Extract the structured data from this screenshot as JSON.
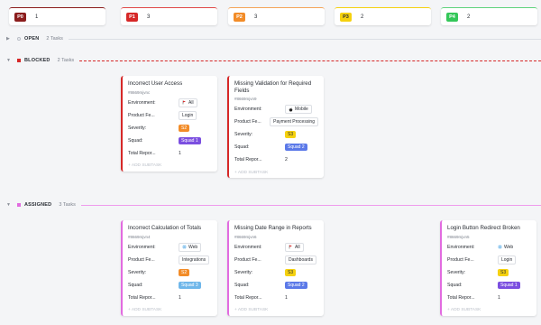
{
  "priorities": [
    {
      "badge": "P0",
      "count": "1",
      "bg": "#8b1d1d",
      "fg": "#ffffff",
      "line": "#8b1d1d"
    },
    {
      "badge": "P1",
      "count": "3",
      "bg": "#d62828",
      "fg": "#ffffff",
      "line": "#e04848"
    },
    {
      "badge": "P2",
      "count": "3",
      "bg": "#f28c28",
      "fg": "#ffffff",
      "line": "#f5a458"
    },
    {
      "badge": "P3",
      "count": "2",
      "bg": "#f5d10f",
      "fg": "#292d34",
      "line": "#f5d10f"
    },
    {
      "badge": "P4",
      "count": "2",
      "bg": "#34c759",
      "fg": "#ffffff",
      "line": "#5fd37c"
    }
  ],
  "groups": {
    "open": {
      "name": "OPEN",
      "count": "2 Tasks",
      "color": "#b9bec7"
    },
    "blocked": {
      "name": "BLOCKED",
      "count": "2 Tasks",
      "color": "#d62828"
    },
    "assigned": {
      "name": "ASSIGNED",
      "count": "3 Tasks",
      "color": "#e26be0"
    }
  },
  "labels": {
    "environment": "Environment:",
    "product": "Product Fe...",
    "severity": "Severity:",
    "squad": "Squad:",
    "total": "Total Repor...",
    "add_subtask": "+ ADD SUBTASK"
  },
  "blocked_cards": [
    {
      "title": "Incorrect User Access",
      "id": "#8669mjvnc",
      "env": "All",
      "env_icon": "flag-icon",
      "product": "Login",
      "severity": "S2",
      "sev_color": "#f28c28",
      "squad": "Squad 1",
      "squad_color": "#7b4fe0",
      "total": "1"
    },
    {
      "title": "Missing Validation for Required Fields",
      "id": "#8669mjvn9",
      "env": "Mobile",
      "env_icon": "apple-icon",
      "product": "Payment Processing",
      "severity": "S3",
      "sev_color": "#f5d10f",
      "squad": "Squad 2",
      "squad_color": "#5b79e8",
      "total": "2"
    }
  ],
  "assigned_cards": [
    {
      "title": "Incorrect Calculation of Totals",
      "id": "#8669mjvn4",
      "env": "Web",
      "env_icon": "globe-icon",
      "product": "Integrations",
      "severity": "S2",
      "sev_color": "#f28c28",
      "squad": "Squad 3",
      "squad_color": "#6fb7ea",
      "total": "1"
    },
    {
      "title": "Missing Date Range in Reports",
      "id": "#8669mjvn6",
      "env": "All",
      "env_icon": "flag-icon",
      "product": "Dashboards",
      "severity": "S3",
      "sev_color": "#f5d10f",
      "squad": "Squad 2",
      "squad_color": "#5b79e8",
      "total": "1"
    },
    {
      "title": "Login Button Redirect Broken",
      "id": "#8669mjvn5",
      "env": "Web",
      "env_icon": "globe-icon",
      "product": "Login",
      "severity": "S3",
      "sev_color": "#f5d10f",
      "squad": "Squad 1",
      "squad_color": "#7b4fe0",
      "total": "1"
    }
  ]
}
